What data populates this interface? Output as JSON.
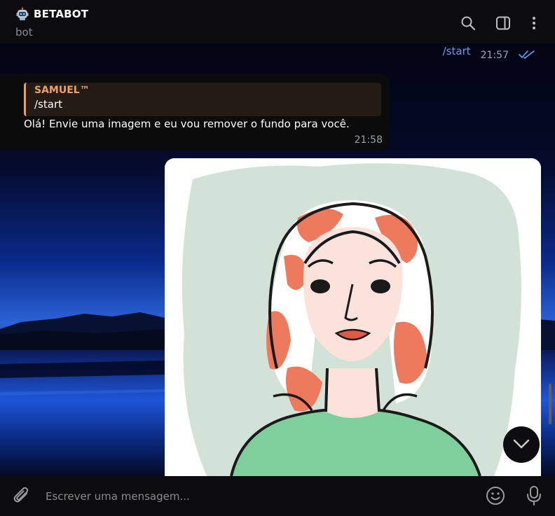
{
  "header": {
    "bot_emoji_icon": "robot-icon",
    "title": "BETABOT",
    "subtitle": "bot",
    "icons": [
      "search-icon",
      "sidebar-toggle-icon",
      "more-vertical-icon"
    ]
  },
  "messages": {
    "outgoing": {
      "text": "/start",
      "time": "21:57",
      "status_icon": "double-check-icon"
    },
    "incoming": {
      "reply_to": {
        "name": "SAMUEL™",
        "text": "/start"
      },
      "text": "Olá! Envie uma imagem e eu vou remover o fundo para você.",
      "time": "21:58"
    },
    "photo": {
      "description_icon": "woman-illustration-image"
    }
  },
  "composer": {
    "placeholder": "Escrever uma mensagem...",
    "icons": [
      "paperclip-icon",
      "emoji-icon",
      "microphone-icon"
    ]
  },
  "colors": {
    "accent_link": "#6a9ef0",
    "reply_name": "#f0a05f",
    "reply_bar": "#e6a06a",
    "background": "#000000"
  }
}
